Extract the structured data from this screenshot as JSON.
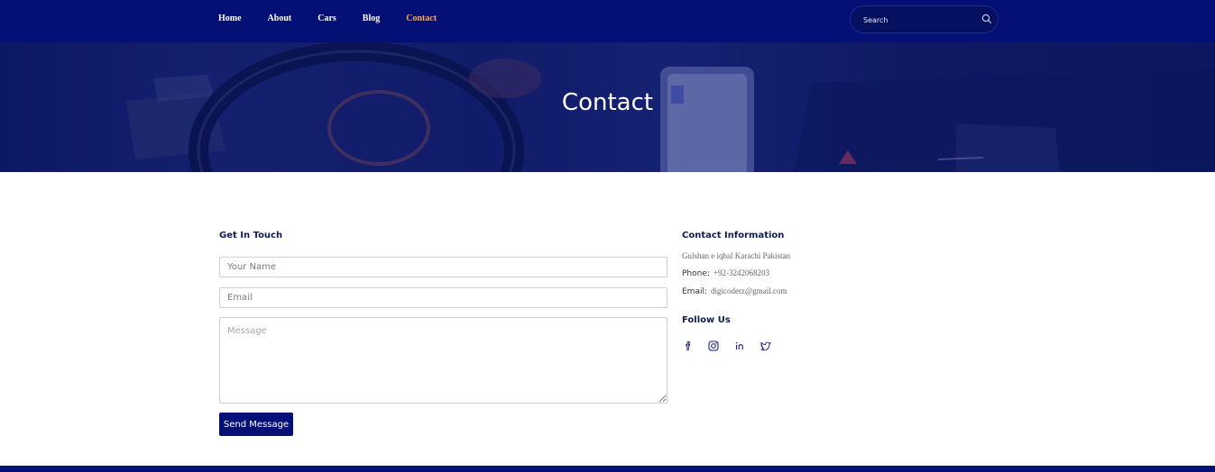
{
  "nav": {
    "links": [
      "Home",
      "About",
      "Cars",
      "Blog",
      "Contact"
    ],
    "active": "Contact",
    "search_placeholder": "Search"
  },
  "hero": {
    "title": "Contact"
  },
  "form": {
    "title": "Get In Touch",
    "name_placeholder": "Your Name",
    "email_placeholder": "Email",
    "message_placeholder": "Message",
    "submit_label": "Send Message"
  },
  "contact": {
    "title": "Contact Information",
    "address": "Gulshan e iqbal Karachi Pakistan",
    "phone_label": "Phone:",
    "phone": "+92-3242068203",
    "email_label": "Email:",
    "email": "digicoderz@gmail.com",
    "follow_title": "Follow Us",
    "social_icons": [
      "facebook-icon",
      "instagram-icon",
      "linkedin-icon",
      "twitter-icon"
    ]
  },
  "colors": {
    "navy": "#051077",
    "active_link": "#f5a46a",
    "heading": "#111b55"
  }
}
